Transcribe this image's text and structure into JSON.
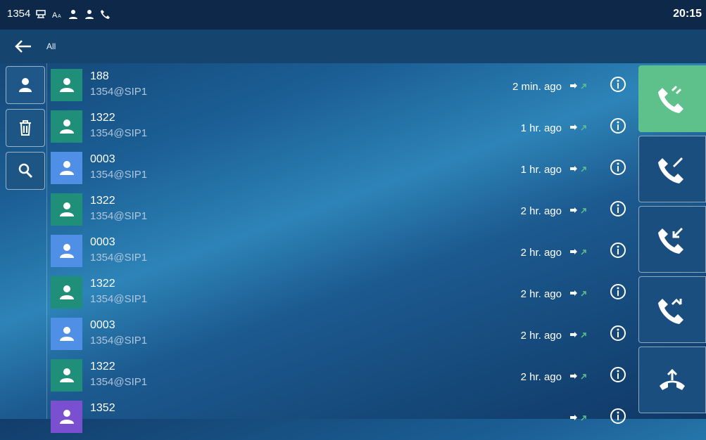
{
  "status": {
    "account": "1354",
    "time": "20:15",
    "icons": [
      "network-icon",
      "font-size-icon",
      "contacts-icon",
      "user-icon",
      "call-forward-icon"
    ]
  },
  "header": {
    "title": "All"
  },
  "left_toolbar": [
    "contact-icon",
    "delete-icon",
    "search-icon"
  ],
  "calls": [
    {
      "name": "188",
      "account": "1354@SIP1",
      "time": "2 min. ago",
      "avatar_color": "#1f8f7a"
    },
    {
      "name": "1322",
      "account": "1354@SIP1",
      "time": "1 hr. ago",
      "avatar_color": "#1f8f7a"
    },
    {
      "name": "0003",
      "account": "1354@SIP1",
      "time": "1 hr. ago",
      "avatar_color": "#4f8fe6"
    },
    {
      "name": "1322",
      "account": "1354@SIP1",
      "time": "2 hr. ago",
      "avatar_color": "#1f8f7a"
    },
    {
      "name": "0003",
      "account": "1354@SIP1",
      "time": "2 hr. ago",
      "avatar_color": "#4f8fe6"
    },
    {
      "name": "1322",
      "account": "1354@SIP1",
      "time": "2 hr. ago",
      "avatar_color": "#1f8f7a"
    },
    {
      "name": "0003",
      "account": "1354@SIP1",
      "time": "2 hr. ago",
      "avatar_color": "#4f8fe6"
    },
    {
      "name": "1322",
      "account": "1354@SIP1",
      "time": "2 hr. ago",
      "avatar_color": "#1f8f7a"
    },
    {
      "name": "1352",
      "account": "",
      "time": "",
      "avatar_color": "#7a4fd0"
    }
  ],
  "right_tabs": [
    "all-calls-icon",
    "dialed-calls-icon",
    "received-calls-icon",
    "missed-calls-icon",
    "forwarded-calls-icon"
  ],
  "colors": {
    "accent_green": "#5ec08a",
    "statusbar": "#0d2849"
  }
}
